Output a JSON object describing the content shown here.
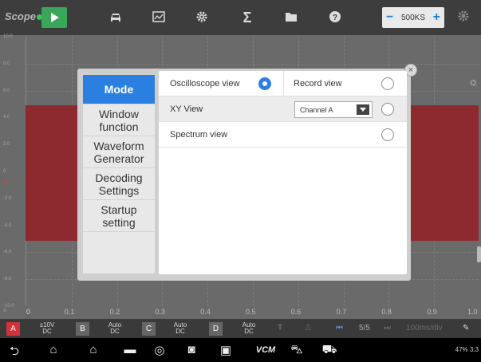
{
  "toolbar": {
    "logo": "Scope",
    "icons": [
      "car-icon",
      "chart-icon",
      "gear-icon",
      "sigma-icon",
      "folder-icon",
      "help-icon"
    ],
    "sample_rate": "500KS",
    "rate_minus": "−",
    "rate_plus": "+"
  },
  "scope": {
    "y_labels": [
      "10.0",
      "8.0",
      "6.0",
      "4.0",
      "2.0",
      "0",
      "-2.0",
      "-4.0",
      "-6.0",
      "-8.0",
      "-10.0"
    ],
    "y_unit": "A",
    "x_labels": [
      "0.1",
      "0.2",
      "0.3",
      "0.4",
      "0.5",
      "0.6",
      "0.7",
      "0.8",
      "0.9",
      "1.0"
    ],
    "x_origin": "0"
  },
  "dialog": {
    "close": "×",
    "sidebar": [
      "Mode",
      "Window function",
      "Waveform Generator",
      "Decoding Settings",
      "Startup setting"
    ],
    "options": {
      "oscilloscope_view": "Oscilloscope view",
      "record_view": "Record view",
      "xy_view": "XY View",
      "channel_select": "Channel A",
      "spectrum_view": "Spectrum view"
    }
  },
  "channels": [
    {
      "name": "A",
      "range": "±10V",
      "coupling": "DC",
      "color": "#d2333a"
    },
    {
      "name": "B",
      "range": "Auto",
      "coupling": "DC",
      "color": "#666666"
    },
    {
      "name": "C",
      "range": "Auto",
      "coupling": "DC",
      "color": "#666666"
    },
    {
      "name": "D",
      "range": "Auto",
      "coupling": "DC",
      "color": "#666666"
    }
  ],
  "controls": {
    "trigger": "T",
    "page": "5/5",
    "timebase": "100ms/div"
  },
  "status": {
    "text": "47% 3:3"
  }
}
